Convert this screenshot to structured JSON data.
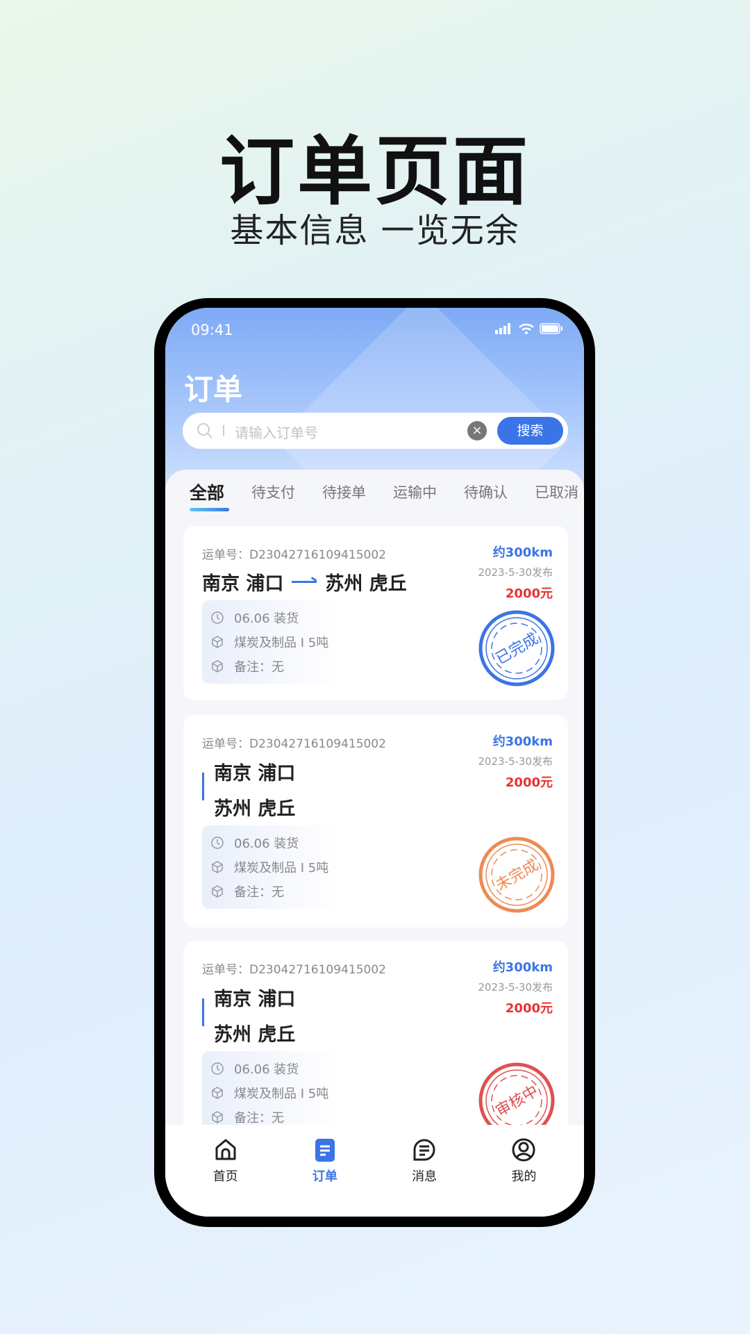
{
  "hero": {
    "title": "订单页面",
    "subtitle": "基本信息 一览无余"
  },
  "status_bar": {
    "time": "09:41"
  },
  "header": {
    "title": "订单"
  },
  "search": {
    "placeholder": "请输入订单号",
    "button": "搜索"
  },
  "tabs": [
    {
      "label": "全部",
      "active": true
    },
    {
      "label": "待支付"
    },
    {
      "label": "待接单"
    },
    {
      "label": "运输中"
    },
    {
      "label": "待确认"
    },
    {
      "label": "已取消"
    }
  ],
  "orders": [
    {
      "waybill": "运单号：D23042716109415002",
      "from": "南京 浦口",
      "to": "苏州 虎丘",
      "distance": "约300km",
      "date": "2023-5-30发布",
      "price": "2000元",
      "load": "06.06  装货",
      "cargo": "煤炭及制品  I  5吨",
      "note": "备注：无",
      "status": "已完成",
      "status_color": "#3a74e6"
    },
    {
      "waybill": "运单号：D23042716109415002",
      "from": "南京 浦口",
      "to": "苏州 虎丘",
      "distance": "约300km",
      "date": "2023-5-30发布",
      "price": "2000元",
      "load": "06.06  装货",
      "cargo": "煤炭及制品  I  5吨",
      "note": "备注：无",
      "status": "未完成",
      "status_color": "#ee8a55"
    },
    {
      "waybill": "运单号：D23042716109415002",
      "from": "南京 浦口",
      "to": "苏州 虎丘",
      "distance": "约300km",
      "date": "2023-5-30发布",
      "price": "2000元",
      "load": "06.06  装货",
      "cargo": "煤炭及制品  I  5吨",
      "note": "备注：无",
      "status": "审核中",
      "status_color": "#e05050"
    }
  ],
  "nav": [
    {
      "label": "首页",
      "icon": "home-icon"
    },
    {
      "label": "订单",
      "icon": "order-icon",
      "active": true
    },
    {
      "label": "消息",
      "icon": "message-icon"
    },
    {
      "label": "我的",
      "icon": "profile-icon"
    }
  ],
  "colors": {
    "accent": "#3a74e6",
    "price": "#e53232"
  }
}
